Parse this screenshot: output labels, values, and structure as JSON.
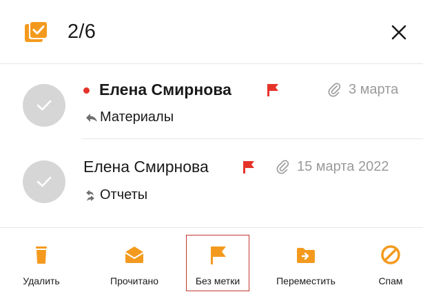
{
  "colors": {
    "accent": "#F39A1E",
    "flag": "#E5332A",
    "unread_dot": "#E5332A",
    "date_gray": "#9A9A9A",
    "avatar_gray": "#D6D6D6",
    "highlight_border": "#C0392B"
  },
  "header": {
    "select_icon": "checked-stack-icon",
    "selection_count": "2/6",
    "close_icon": "close-icon"
  },
  "messages": [
    {
      "sender": "Елена Смирнова",
      "unread": true,
      "flagged": true,
      "has_attachment": true,
      "date": "3 марта",
      "status_icon": "reply-icon",
      "subject": "Материалы",
      "selected": true
    },
    {
      "sender": "Елена Смирнова",
      "unread": false,
      "flagged": true,
      "has_attachment": true,
      "date": "15 марта 2022",
      "status_icon": "reply-forward-icon",
      "subject": "Отчеты",
      "selected": true
    }
  ],
  "toolbar": {
    "delete_label": "Удалить",
    "read_label": "Прочитано",
    "unflag_label": "Без метки",
    "move_label": "Переместить",
    "spam_label": "Спам"
  }
}
